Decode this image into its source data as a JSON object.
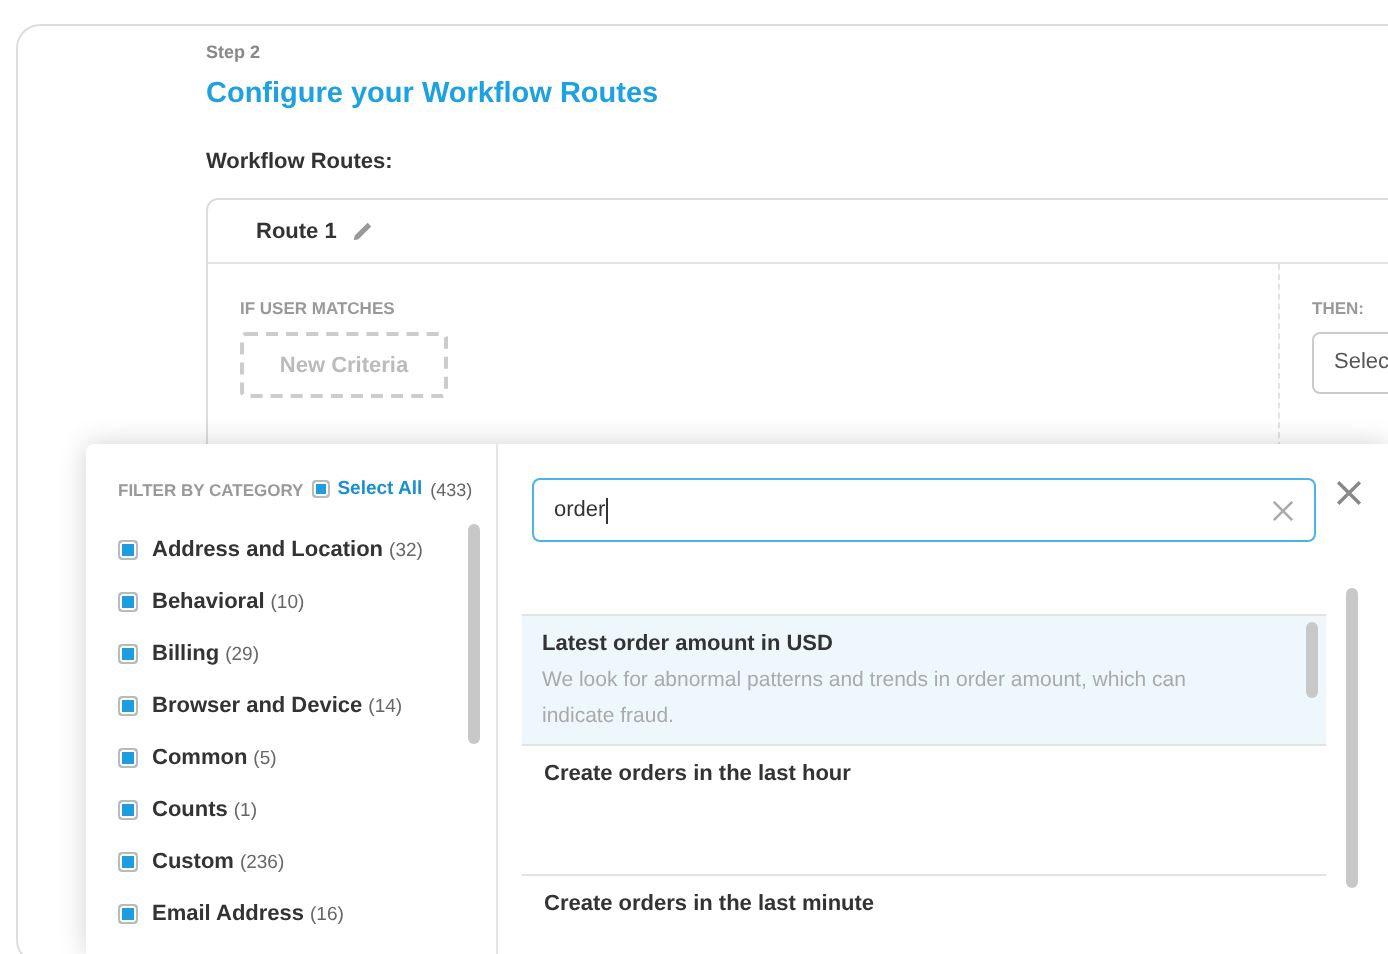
{
  "step": "Step 2",
  "title": "Configure your Workflow Routes",
  "section_label": "Workflow Routes:",
  "route": {
    "name": "Route 1",
    "condition_label": "IF USER MATCHES",
    "criteria_button": "New Criteria",
    "then_label": "THEN:",
    "then_select": "Selec"
  },
  "filter": {
    "heading": "FILTER BY CATEGORY",
    "select_all": {
      "label": "Select All",
      "count": "(433)",
      "checked": true
    },
    "categories": [
      {
        "name": "Address and Location",
        "count": "(32)",
        "checked": true
      },
      {
        "name": "Behavioral",
        "count": "(10)",
        "checked": true
      },
      {
        "name": "Billing",
        "count": "(29)",
        "checked": true
      },
      {
        "name": "Browser and Device",
        "count": "(14)",
        "checked": true
      },
      {
        "name": "Common",
        "count": "(5)",
        "checked": true
      },
      {
        "name": "Counts",
        "count": "(1)",
        "checked": true
      },
      {
        "name": "Custom",
        "count": "(236)",
        "checked": true
      },
      {
        "name": "Email Address",
        "count": "(16)",
        "checked": true
      }
    ]
  },
  "search": {
    "value": "order"
  },
  "results": [
    {
      "title": "Latest order amount in USD",
      "description": "We look for abnormal patterns and trends in order amount, which can indicate fraud.",
      "selected": true
    },
    {
      "title": "Create orders in the last hour",
      "selected": false
    },
    {
      "title": "Create orders in the last minute",
      "selected": false
    }
  ]
}
